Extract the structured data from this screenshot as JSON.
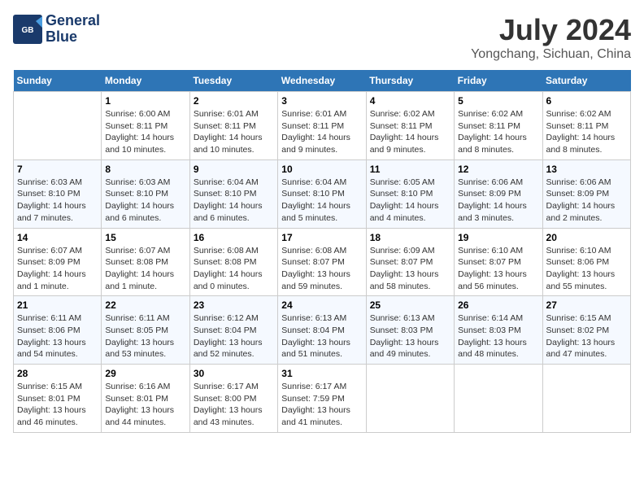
{
  "header": {
    "logo_line1": "General",
    "logo_line2": "Blue",
    "month_year": "July 2024",
    "location": "Yongchang, Sichuan, China"
  },
  "weekdays": [
    "Sunday",
    "Monday",
    "Tuesday",
    "Wednesday",
    "Thursday",
    "Friday",
    "Saturday"
  ],
  "weeks": [
    [
      {
        "num": "",
        "info": ""
      },
      {
        "num": "1",
        "info": "Sunrise: 6:00 AM\nSunset: 8:11 PM\nDaylight: 14 hours\nand 10 minutes."
      },
      {
        "num": "2",
        "info": "Sunrise: 6:01 AM\nSunset: 8:11 PM\nDaylight: 14 hours\nand 10 minutes."
      },
      {
        "num": "3",
        "info": "Sunrise: 6:01 AM\nSunset: 8:11 PM\nDaylight: 14 hours\nand 9 minutes."
      },
      {
        "num": "4",
        "info": "Sunrise: 6:02 AM\nSunset: 8:11 PM\nDaylight: 14 hours\nand 9 minutes."
      },
      {
        "num": "5",
        "info": "Sunrise: 6:02 AM\nSunset: 8:11 PM\nDaylight: 14 hours\nand 8 minutes."
      },
      {
        "num": "6",
        "info": "Sunrise: 6:02 AM\nSunset: 8:11 PM\nDaylight: 14 hours\nand 8 minutes."
      }
    ],
    [
      {
        "num": "7",
        "info": "Sunrise: 6:03 AM\nSunset: 8:10 PM\nDaylight: 14 hours\nand 7 minutes."
      },
      {
        "num": "8",
        "info": "Sunrise: 6:03 AM\nSunset: 8:10 PM\nDaylight: 14 hours\nand 6 minutes."
      },
      {
        "num": "9",
        "info": "Sunrise: 6:04 AM\nSunset: 8:10 PM\nDaylight: 14 hours\nand 6 minutes."
      },
      {
        "num": "10",
        "info": "Sunrise: 6:04 AM\nSunset: 8:10 PM\nDaylight: 14 hours\nand 5 minutes."
      },
      {
        "num": "11",
        "info": "Sunrise: 6:05 AM\nSunset: 8:10 PM\nDaylight: 14 hours\nand 4 minutes."
      },
      {
        "num": "12",
        "info": "Sunrise: 6:06 AM\nSunset: 8:09 PM\nDaylight: 14 hours\nand 3 minutes."
      },
      {
        "num": "13",
        "info": "Sunrise: 6:06 AM\nSunset: 8:09 PM\nDaylight: 14 hours\nand 2 minutes."
      }
    ],
    [
      {
        "num": "14",
        "info": "Sunrise: 6:07 AM\nSunset: 8:09 PM\nDaylight: 14 hours\nand 1 minute."
      },
      {
        "num": "15",
        "info": "Sunrise: 6:07 AM\nSunset: 8:08 PM\nDaylight: 14 hours\nand 1 minute."
      },
      {
        "num": "16",
        "info": "Sunrise: 6:08 AM\nSunset: 8:08 PM\nDaylight: 14 hours\nand 0 minutes."
      },
      {
        "num": "17",
        "info": "Sunrise: 6:08 AM\nSunset: 8:07 PM\nDaylight: 13 hours\nand 59 minutes."
      },
      {
        "num": "18",
        "info": "Sunrise: 6:09 AM\nSunset: 8:07 PM\nDaylight: 13 hours\nand 58 minutes."
      },
      {
        "num": "19",
        "info": "Sunrise: 6:10 AM\nSunset: 8:07 PM\nDaylight: 13 hours\nand 56 minutes."
      },
      {
        "num": "20",
        "info": "Sunrise: 6:10 AM\nSunset: 8:06 PM\nDaylight: 13 hours\nand 55 minutes."
      }
    ],
    [
      {
        "num": "21",
        "info": "Sunrise: 6:11 AM\nSunset: 8:06 PM\nDaylight: 13 hours\nand 54 minutes."
      },
      {
        "num": "22",
        "info": "Sunrise: 6:11 AM\nSunset: 8:05 PM\nDaylight: 13 hours\nand 53 minutes."
      },
      {
        "num": "23",
        "info": "Sunrise: 6:12 AM\nSunset: 8:04 PM\nDaylight: 13 hours\nand 52 minutes."
      },
      {
        "num": "24",
        "info": "Sunrise: 6:13 AM\nSunset: 8:04 PM\nDaylight: 13 hours\nand 51 minutes."
      },
      {
        "num": "25",
        "info": "Sunrise: 6:13 AM\nSunset: 8:03 PM\nDaylight: 13 hours\nand 49 minutes."
      },
      {
        "num": "26",
        "info": "Sunrise: 6:14 AM\nSunset: 8:03 PM\nDaylight: 13 hours\nand 48 minutes."
      },
      {
        "num": "27",
        "info": "Sunrise: 6:15 AM\nSunset: 8:02 PM\nDaylight: 13 hours\nand 47 minutes."
      }
    ],
    [
      {
        "num": "28",
        "info": "Sunrise: 6:15 AM\nSunset: 8:01 PM\nDaylight: 13 hours\nand 46 minutes."
      },
      {
        "num": "29",
        "info": "Sunrise: 6:16 AM\nSunset: 8:01 PM\nDaylight: 13 hours\nand 44 minutes."
      },
      {
        "num": "30",
        "info": "Sunrise: 6:17 AM\nSunset: 8:00 PM\nDaylight: 13 hours\nand 43 minutes."
      },
      {
        "num": "31",
        "info": "Sunrise: 6:17 AM\nSunset: 7:59 PM\nDaylight: 13 hours\nand 41 minutes."
      },
      {
        "num": "",
        "info": ""
      },
      {
        "num": "",
        "info": ""
      },
      {
        "num": "",
        "info": ""
      }
    ]
  ]
}
